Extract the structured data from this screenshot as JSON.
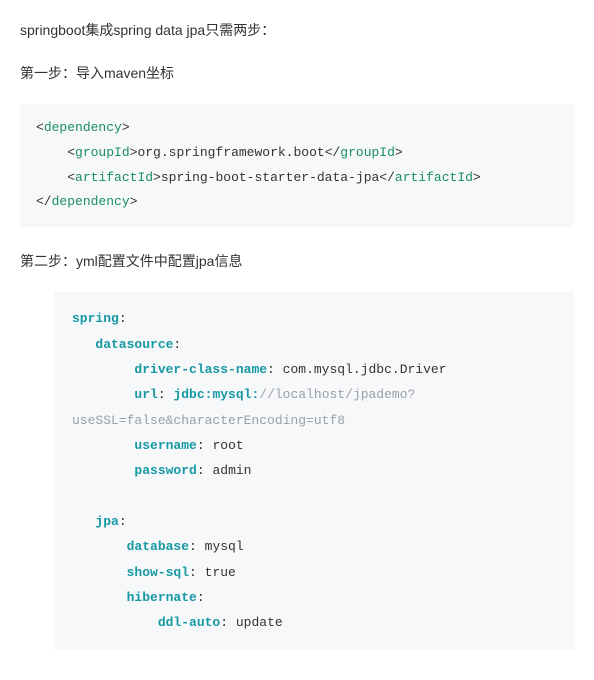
{
  "intro": "springboot集成spring data jpa只需两步：",
  "step1_title": "第一步：导入maven坐标",
  "step2_title": "第二步：yml配置文件中配置jpa信息",
  "xml": {
    "dependency": "dependency",
    "groupId": "groupId",
    "artifactId": "artifactId",
    "groupId_val": "org.springframework.boot",
    "artifactId_val": "spring-boot-starter-data-jpa"
  },
  "yml": {
    "spring": "spring",
    "datasource": "datasource",
    "driver_class_name_key": "driver-class-name",
    "driver_class_name_val": "com.mysql.jdbc.Driver",
    "url_key": "url",
    "url_prefix": "jdbc:mysql:",
    "url_rest": "//localhost/jpademo?",
    "url_line2": "useSSL=false&characterEncoding=utf8",
    "username_key": "username",
    "username_val": "root",
    "password_key": "password",
    "password_val": "admin",
    "jpa": "jpa",
    "database_key": "database",
    "database_val": "mysql",
    "show_sql_key": "show-sql",
    "show_sql_val": "true",
    "hibernate": "hibernate",
    "ddl_auto_key": "ddl-auto",
    "ddl_auto_val": "update"
  }
}
